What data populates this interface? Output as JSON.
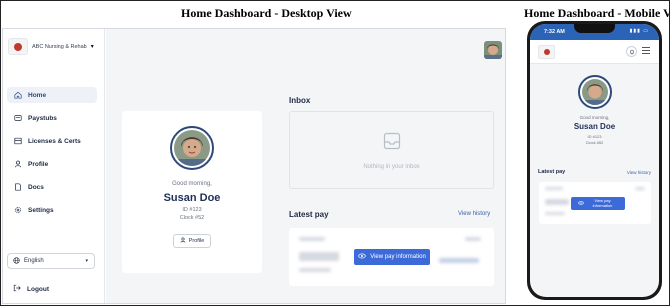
{
  "captions": {
    "desktop": "Home Dashboard - Desktop View",
    "mobile": "Home Dashboard - Mobile View"
  },
  "brand": {
    "name": "ABC Nursing & Rehab"
  },
  "sidebar": {
    "items": [
      {
        "label": "Home",
        "icon": "home-icon",
        "active": true
      },
      {
        "label": "Paystubs",
        "icon": "paystub-icon",
        "active": false
      },
      {
        "label": "Licenses & Certs",
        "icon": "certificate-icon",
        "active": false
      },
      {
        "label": "Profile",
        "icon": "user-icon",
        "active": false
      },
      {
        "label": "Docs",
        "icon": "document-icon",
        "active": false
      },
      {
        "label": "Settings",
        "icon": "gear-icon",
        "active": false
      }
    ],
    "language": "English",
    "logout": "Logout"
  },
  "profile": {
    "greeting": "Good morning,",
    "name": "Susan Doe",
    "id": "ID #123",
    "clock": "Clock #52",
    "button": "Profile"
  },
  "inbox": {
    "title": "Inbox",
    "empty_text": "Nothing in your inbox"
  },
  "latest_pay": {
    "title": "Latest pay",
    "view_history": "View history",
    "button": "View pay information"
  },
  "mobile": {
    "time": "7:32 AM",
    "greeting": "Good morning,",
    "name": "Susan Doe",
    "id": "ID #123",
    "clock": "Clock #52",
    "latest_title": "Latest pay",
    "view_history": "View history",
    "pay_button": "View pay information"
  },
  "colors": {
    "primary": "#3c6bd9",
    "navy": "#1e3056",
    "status_bar": "#2b63b6",
    "background": "#f4f5f7"
  }
}
